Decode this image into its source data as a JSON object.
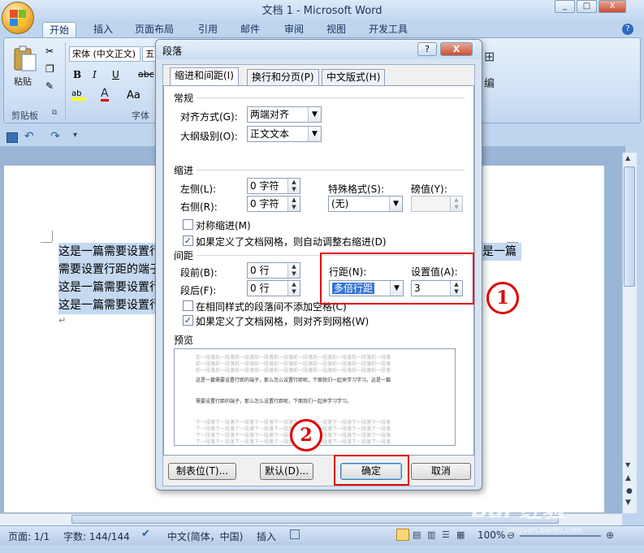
{
  "window": {
    "title": "文档 1 - Microsoft Word",
    "min": "_",
    "max": "□",
    "close": "X"
  },
  "ribbon_tabs": [
    "开始",
    "插入",
    "页面布局",
    "引用",
    "邮件",
    "审阅",
    "视图",
    "开发工具"
  ],
  "ribbon": {
    "paste_label": "粘贴",
    "clipboard_group": "剪贴板",
    "font_group": "字体",
    "font_name": "宋体 (中文正文)",
    "font_size": "五",
    "bold": "B",
    "italic": "I",
    "underline": "U",
    "strike": "abc",
    "aa": "Aa",
    "edit_label": "编"
  },
  "document": {
    "lines": [
      "这是一篇需要设置行",
      "需要设置行距的端子",
      "这是一篇需要设置行",
      "这是一篇需要设置行"
    ],
    "right_fragment": "是一篇",
    "para_mark": "↵"
  },
  "status": {
    "page": "页面: 1/1",
    "words": "字数: 144/144",
    "lang": "中文(简体，中国)",
    "insert": "插入",
    "zoom": "100%"
  },
  "dialog": {
    "title": "段落",
    "help": "?",
    "close": "X",
    "tabs": [
      "缩进和间距(I)",
      "换行和分页(P)",
      "中文版式(H)"
    ],
    "general": {
      "section": "常规",
      "align_label": "对齐方式(G):",
      "align_value": "两端对齐",
      "outline_label": "大纲级别(O):",
      "outline_value": "正文文本"
    },
    "indent": {
      "section": "缩进",
      "left_label": "左侧(L):",
      "left_value": "0 字符",
      "right_label": "右侧(R):",
      "right_value": "0 字符",
      "special_label": "特殊格式(S):",
      "special_value": "(无)",
      "by_label": "磅值(Y):",
      "mirror_label": "对称缩进(M)",
      "mirror_checked": false,
      "auto_label": "如果定义了文档网格，则自动调整右缩进(D)",
      "auto_checked": true
    },
    "spacing": {
      "section": "间距",
      "before_label": "段前(B):",
      "before_value": "0 行",
      "after_label": "段后(F):",
      "after_value": "0 行",
      "line_label": "行距(N):",
      "line_value": "多倍行距",
      "at_label": "设置值(A):",
      "at_value": "3",
      "nospace_label": "在相同样式的段落间不添加空格(C)",
      "nospace_checked": false,
      "grid_label": "如果定义了文档网格，则对齐到网格(W)",
      "grid_checked": true
    },
    "preview": {
      "section": "预览",
      "gray_line": "前一段落前一段落前一段落前一段落前一段落前一段落前一段落前一段落前一段落前一段落",
      "sample1": "这是一篇需要设置行距的端子，那么怎么设置行距呢，下面我们一起来学习学习。这是一篇",
      "sample2": "需要设置行距的端子，那么怎么设置行距呢，下面我们一起来学习学习。",
      "after_line": "下一段落下一段落下一段落下一段落下一段落下一段落下一段落下一段落下一段落下一段落"
    },
    "buttons": {
      "tabs": "制表位(T)...",
      "default": "默认(D)...",
      "ok": "确定",
      "cancel": "取消"
    }
  },
  "annotations": {
    "marker1": "1",
    "marker2": "2",
    "annotation_color": "#e00000"
  },
  "watermark": {
    "text": "Bai 经验",
    "sub": "jingyan.baidu.com"
  }
}
